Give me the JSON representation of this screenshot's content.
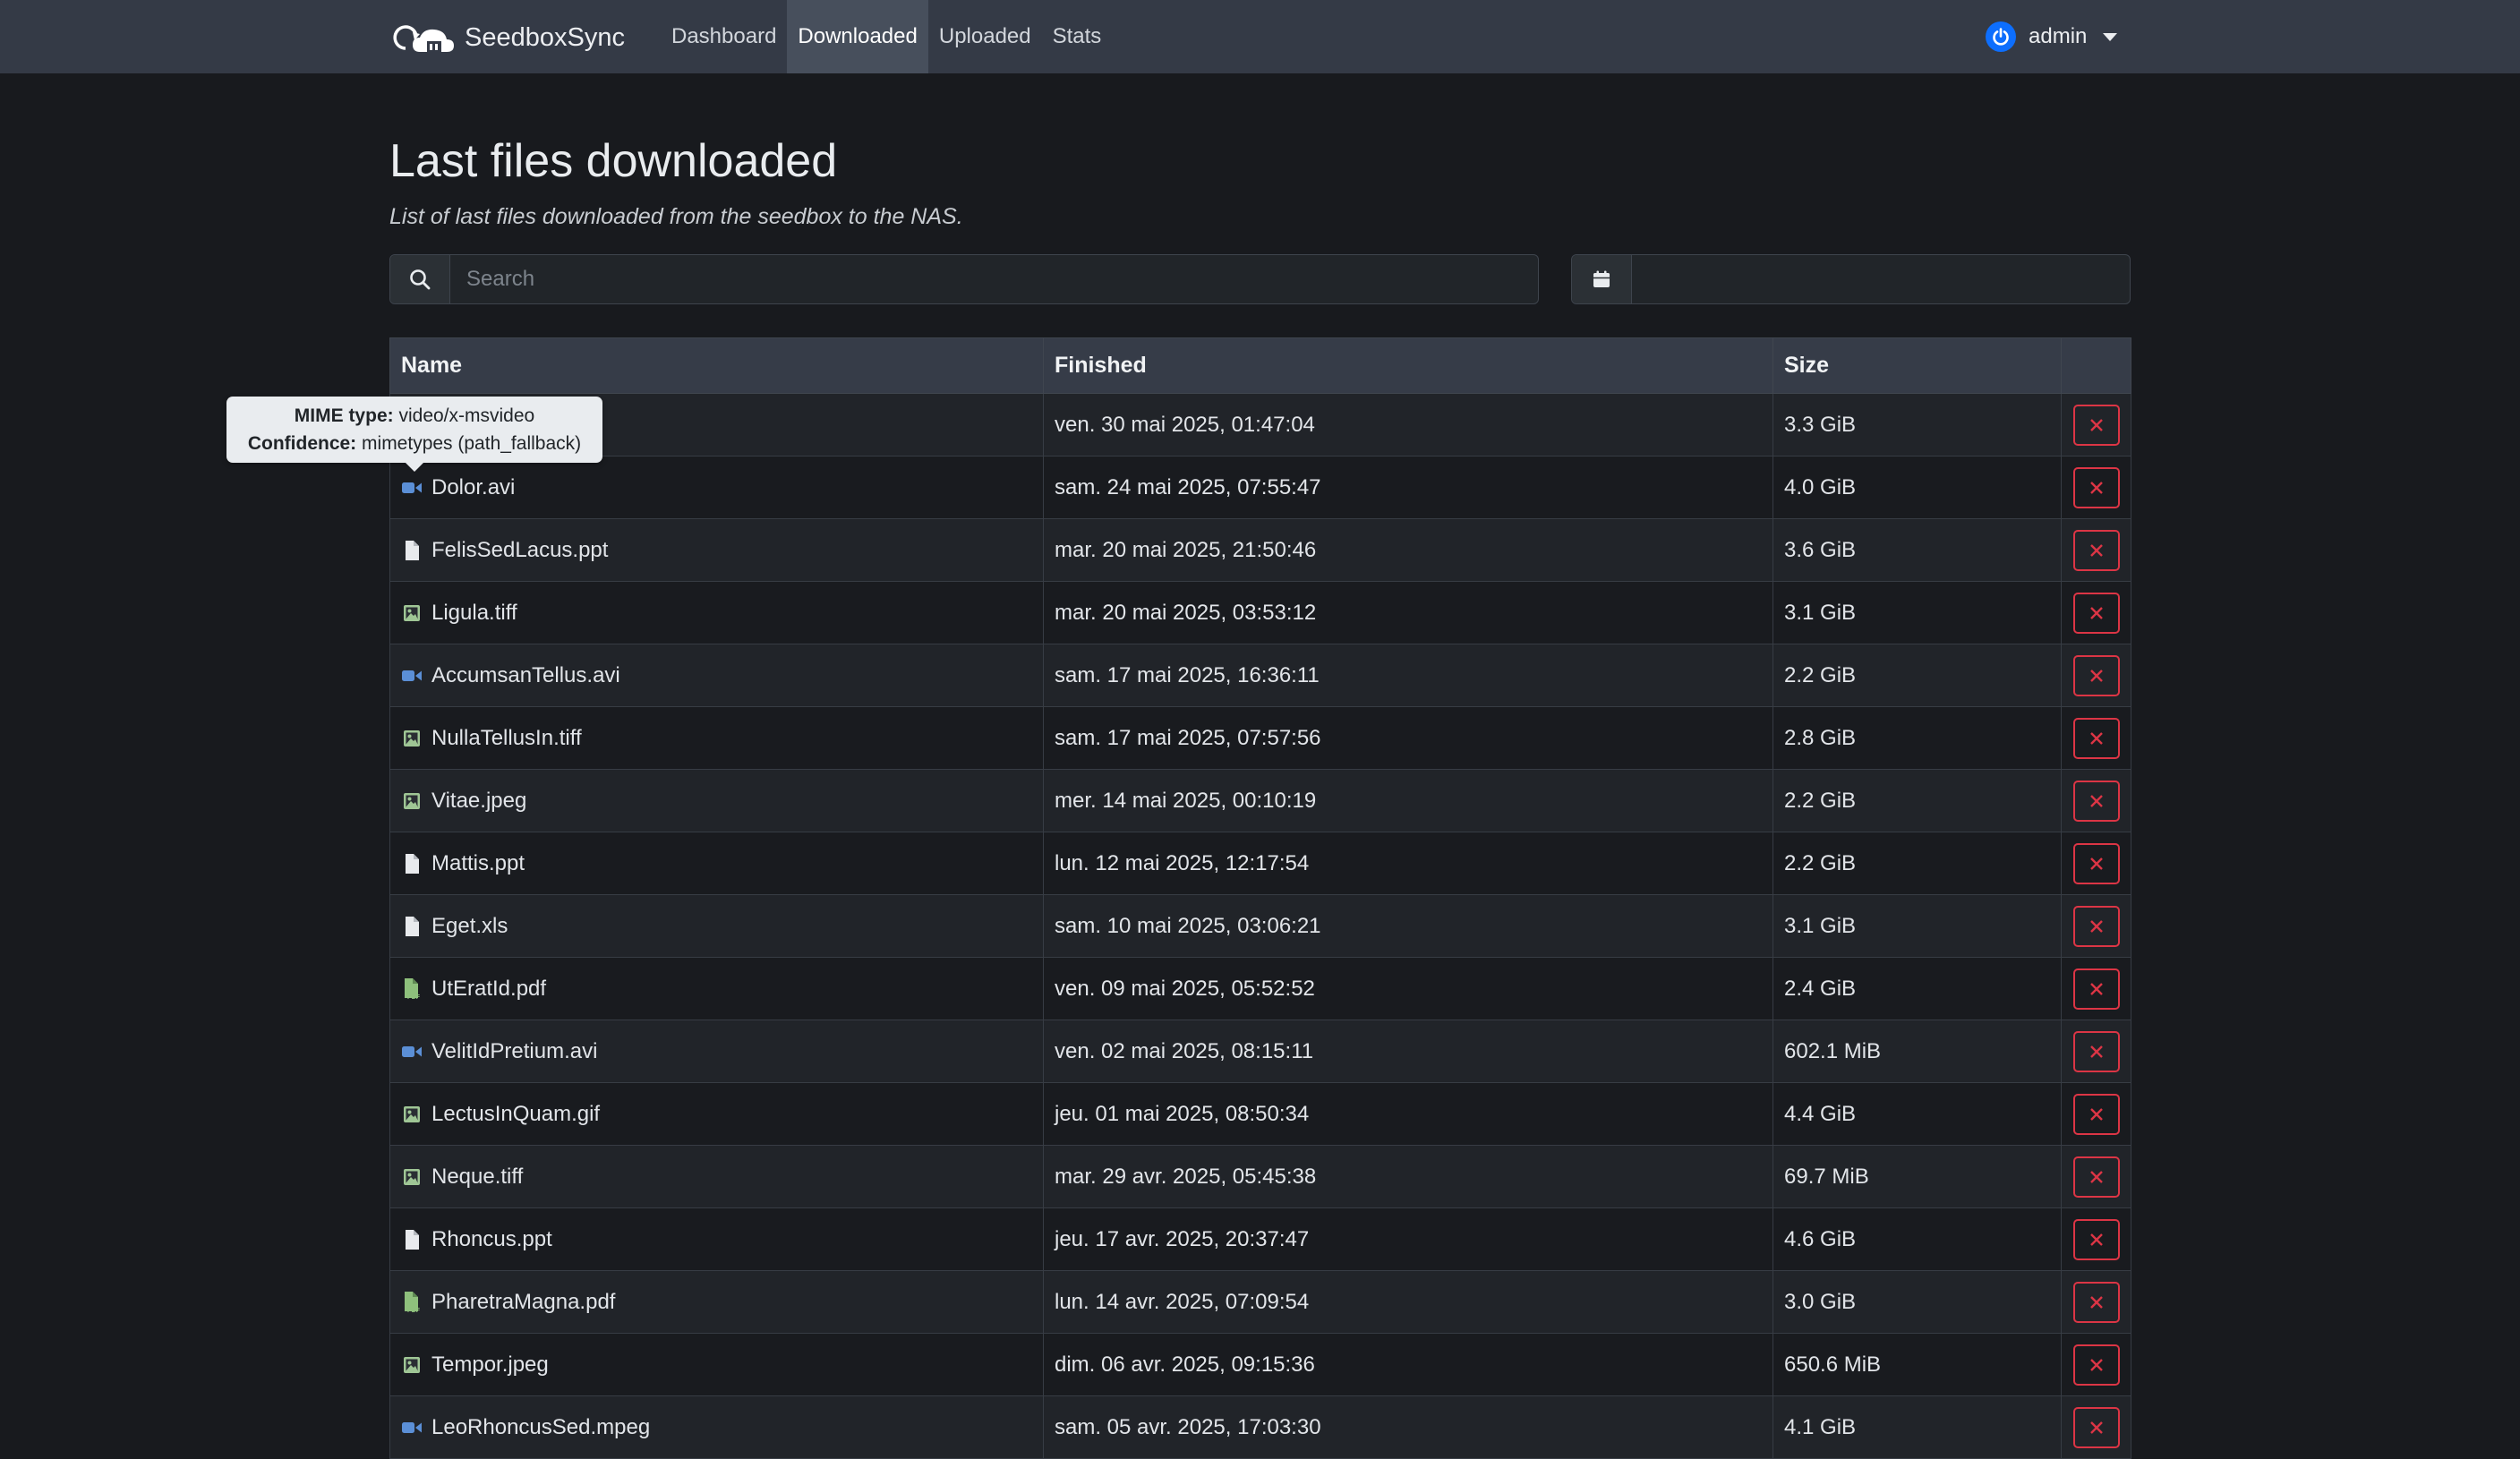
{
  "app": {
    "brand": "SeedboxSync"
  },
  "nav": {
    "items": [
      {
        "label": "Dashboard",
        "active": false
      },
      {
        "label": "Downloaded",
        "active": true
      },
      {
        "label": "Uploaded",
        "active": false
      },
      {
        "label": "Stats",
        "active": false
      }
    ],
    "user": "admin"
  },
  "page": {
    "title": "Last files downloaded",
    "subtitle": "List of last files downloaded from the seedbox to the NAS."
  },
  "search": {
    "placeholder": "Search",
    "value": ""
  },
  "date_filter": {
    "value": ""
  },
  "table": {
    "columns": {
      "name": "Name",
      "finished": "Finished",
      "size": "Size"
    },
    "rows": [
      {
        "name": "",
        "finished": "ven. 30 mai 2025, 01:47:04",
        "size": "3.3 GiB",
        "icon": "video-icon"
      },
      {
        "name": "Dolor.avi",
        "finished": "sam. 24 mai 2025, 07:55:47",
        "size": "4.0 GiB",
        "icon": "video-icon"
      },
      {
        "name": "FelisSedLacus.ppt",
        "finished": "mar. 20 mai 2025, 21:50:46",
        "size": "3.6 GiB",
        "icon": "file-icon"
      },
      {
        "name": "Ligula.tiff",
        "finished": "mar. 20 mai 2025, 03:53:12",
        "size": "3.1 GiB",
        "icon": "image-icon"
      },
      {
        "name": "AccumsanTellus.avi",
        "finished": "sam. 17 mai 2025, 16:36:11",
        "size": "2.2 GiB",
        "icon": "video-icon"
      },
      {
        "name": "NullaTellusIn.tiff",
        "finished": "sam. 17 mai 2025, 07:57:56",
        "size": "2.8 GiB",
        "icon": "image-icon"
      },
      {
        "name": "Vitae.jpeg",
        "finished": "mer. 14 mai 2025, 00:10:19",
        "size": "2.2 GiB",
        "icon": "image-icon"
      },
      {
        "name": "Mattis.ppt",
        "finished": "lun. 12 mai 2025, 12:17:54",
        "size": "2.2 GiB",
        "icon": "file-icon"
      },
      {
        "name": "Eget.xls",
        "finished": "sam. 10 mai 2025, 03:06:21",
        "size": "3.1 GiB",
        "icon": "file-icon"
      },
      {
        "name": "UtEratId.pdf",
        "finished": "ven. 09 mai 2025, 05:52:52",
        "size": "2.4 GiB",
        "icon": "pdf-icon"
      },
      {
        "name": "VelitIdPretium.avi",
        "finished": "ven. 02 mai 2025, 08:15:11",
        "size": "602.1 MiB",
        "icon": "video-icon"
      },
      {
        "name": "LectusInQuam.gif",
        "finished": "jeu. 01 mai 2025, 08:50:34",
        "size": "4.4 GiB",
        "icon": "image-icon"
      },
      {
        "name": "Neque.tiff",
        "finished": "mar. 29 avr. 2025, 05:45:38",
        "size": "69.7 MiB",
        "icon": "image-icon"
      },
      {
        "name": "Rhoncus.ppt",
        "finished": "jeu. 17 avr. 2025, 20:37:47",
        "size": "4.6 GiB",
        "icon": "file-icon"
      },
      {
        "name": "PharetraMagna.pdf",
        "finished": "lun. 14 avr. 2025, 07:09:54",
        "size": "3.0 GiB",
        "icon": "pdf-icon"
      },
      {
        "name": "Tempor.jpeg",
        "finished": "dim. 06 avr. 2025, 09:15:36",
        "size": "650.6 MiB",
        "icon": "image-icon"
      },
      {
        "name": "LeoRhoncusSed.mpeg",
        "finished": "sam. 05 avr. 2025, 17:03:30",
        "size": "4.1 GiB",
        "icon": "video-icon"
      }
    ]
  },
  "tooltip": {
    "mime_label": "MIME type:",
    "mime_value": "video/x-msvideo",
    "confidence_label": "Confidence:",
    "confidence_value": "mimetypes (path_fallback)"
  },
  "colors": {
    "video": "#5b8fd6",
    "image": "#9fc695",
    "pdf": "#8ec07c",
    "file": "#e8eaed",
    "danger": "#dc3545",
    "primary": "#0d6efd"
  }
}
